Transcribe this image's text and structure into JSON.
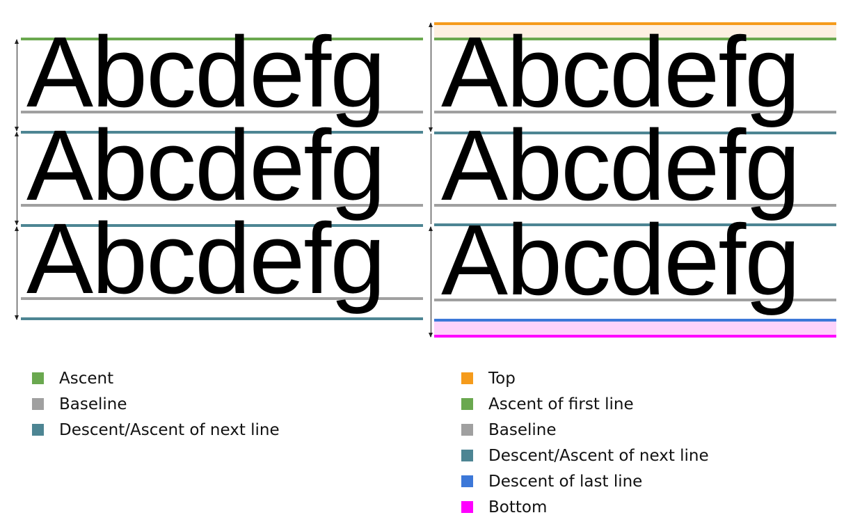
{
  "colors": {
    "top": "#f59b1c",
    "top_band": "#fdf0e1",
    "ascent": "#6aa84f",
    "baseline": "#a0a0a0",
    "descent": "#4d8593",
    "descent_last": "#3c78d8",
    "bottom": "#ff00ff",
    "bottom_band": "#fdd3fb"
  },
  "left_panel": {
    "sample_lines": [
      "Abcdefg",
      "Abcdefg",
      "Abcdefg"
    ]
  },
  "right_panel": {
    "sample_lines": [
      "Abcdefg",
      "Abcdefg",
      "Abcdefg"
    ]
  },
  "legend_left": {
    "items": [
      {
        "label": "Ascent",
        "color_key": "ascent"
      },
      {
        "label": "Baseline",
        "color_key": "baseline"
      },
      {
        "label": "Descent/Ascent of next line",
        "color_key": "descent"
      }
    ]
  },
  "legend_right": {
    "items": [
      {
        "label": "Top",
        "color_key": "top"
      },
      {
        "label": "Ascent of first line",
        "color_key": "ascent"
      },
      {
        "label": "Baseline",
        "color_key": "baseline"
      },
      {
        "label": "Descent/Ascent of next line",
        "color_key": "descent"
      },
      {
        "label": "Descent of last line",
        "color_key": "descent_last"
      },
      {
        "label": "Bottom",
        "color_key": "bottom"
      }
    ]
  }
}
